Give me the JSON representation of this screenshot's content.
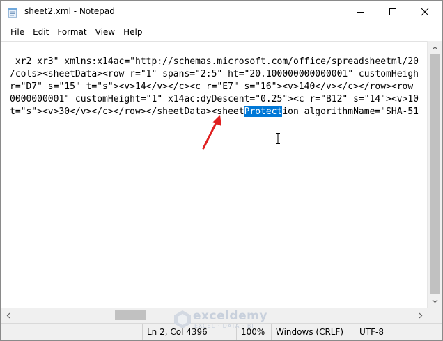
{
  "window": {
    "title": "sheet2.xml - Notepad"
  },
  "menu": {
    "items": [
      "File",
      "Edit",
      "Format",
      "View",
      "Help"
    ]
  },
  "editor": {
    "lines": [
      {
        "text": " xr2 xr3\" xmlns:x14ac=\"http://schemas.microsoft.com/office/spreadsheetml/20"
      },
      {
        "text": "/cols><sheetData><row r=\"1\" spans=\"2:5\" ht=\"20.100000000000001\" customHeigh"
      },
      {
        "text": "r=\"D7\" s=\"15\" t=\"s\"><v>14</v></c><c r=\"E7\" s=\"16\"><v>140</v></c></row><row"
      },
      {
        "text": "0000000001\" customHeight=\"1\" x14ac:dyDescent=\"0.25\"><c r=\"B12\" s=\"14\"><v>10"
      },
      {
        "before": "t=\"s\"><v>30</v></c></row></sheetData><sheet",
        "selected": "Protect",
        "after": "ion algorithmName=\"SHA-51"
      }
    ]
  },
  "status": {
    "position": "Ln 2, Col 4396",
    "zoom": "100%",
    "line_ending": "Windows (CRLF)",
    "encoding": "UTF-8"
  },
  "watermark": {
    "brand": "exceldemy",
    "tagline": "EXCEL · DATA · BI"
  },
  "colors": {
    "selection": "#0078d7",
    "annotation_arrow": "#e02020"
  }
}
